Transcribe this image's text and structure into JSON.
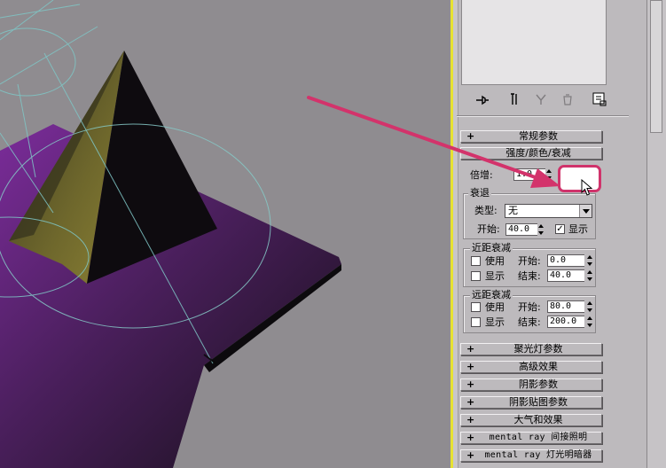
{
  "colors": {
    "accent_arrow": "#d3336b",
    "viewport_bg": "#8f8c90",
    "panel_bg": "#bdbabd",
    "active_border": "#e7e233",
    "plane": "#4a2060",
    "swatch": "#ffffff"
  },
  "icons": [
    "pin-stack-icon",
    "show-end-result-icon",
    "make-unique-icon",
    "remove-modifier-icon",
    "configure-sets-icon",
    "mouse-cursor-icon",
    "increment-spinner-icon"
  ],
  "rollouts": {
    "general": {
      "sign": "+",
      "title": "常规参数"
    },
    "intensity": {
      "sign": "-",
      "title": "强度/颜色/衰减"
    },
    "spotlight": {
      "sign": "+",
      "title": "聚光灯参数"
    },
    "advanced": {
      "sign": "+",
      "title": "高级效果"
    },
    "shadow": {
      "sign": "+",
      "title": "阴影参数"
    },
    "shadowmap": {
      "sign": "+",
      "title": "阴影贴图参数"
    },
    "atmos": {
      "sign": "+",
      "title": "大气和效果"
    },
    "mr_gi": {
      "sign": "+",
      "title": "mental ray 间接照明"
    },
    "mr_shader": {
      "sign": "+",
      "title": "mental ray 灯光明暗器"
    }
  },
  "intensity": {
    "multiplier_label": "倍增:",
    "multiplier_value": "1.0",
    "decay_group": "衰退",
    "type_label": "类型:",
    "type_value": "无",
    "start_label": "开始:",
    "start_value": "40.0",
    "show_label": "显示",
    "show_checked": "✓"
  },
  "near_atten": {
    "group": "近距衰减",
    "use_label": "使用",
    "show_label": "显示",
    "start_label": "开始:",
    "start_value": "0.0",
    "end_label": "结束:",
    "end_value": "40.0"
  },
  "far_atten": {
    "group": "远距衰减",
    "use_label": "使用",
    "show_label": "显示",
    "start_label": "开始:",
    "start_value": "80.0",
    "end_label": "结束:",
    "end_value": "200.0"
  }
}
